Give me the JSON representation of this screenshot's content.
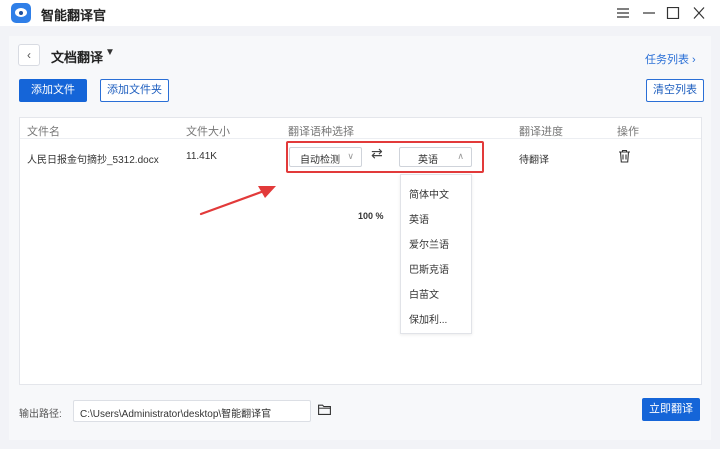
{
  "app": {
    "title": "智能翻译官",
    "accent": "#1565d8"
  },
  "window": {
    "menu_icon": "hamburger-icon",
    "minimize_icon": "minimize-icon",
    "maximize_icon": "maximize-icon",
    "close_icon": "close-icon"
  },
  "header": {
    "back_icon": "chevron-left-icon",
    "page_title": "文档翻译",
    "task_list": "任务列表 ›"
  },
  "toolbar": {
    "add_file": "添加文件",
    "add_folder": "添加文件夹",
    "clear_list": "清空列表"
  },
  "table": {
    "columns": [
      "文件名",
      "文件大小",
      "翻译语种选择",
      "翻译进度",
      "操作"
    ],
    "rows": [
      {
        "file_name": "人民日报金句摘抄_5312.docx",
        "file_size": "11.41K",
        "source_lang": "自动检测",
        "target_lang": "英语",
        "progress": "100 %",
        "status": "待翻译"
      }
    ]
  },
  "dropdown": {
    "options": [
      "简体中文",
      "英语",
      "爱尔兰语",
      "巴斯克语",
      "白苗文",
      "保加利..."
    ]
  },
  "annotation": {
    "highlight_color": "#e23a3a"
  },
  "footer": {
    "output_label": "输出路径:",
    "output_path": "C:\\Users\\Administrator\\desktop\\智能翻译官",
    "translate_now": "立即翻译"
  }
}
